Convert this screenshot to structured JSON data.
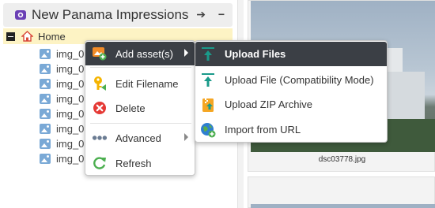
{
  "header": {
    "title": "New Panama Impressions",
    "arrow_glyph": "➔",
    "menu_glyph": "−"
  },
  "tree": {
    "home_label": "Home",
    "items": [
      "img_0",
      "img_0",
      "img_0",
      "img_0",
      "img_0",
      "img_0",
      "img_0",
      "img_0"
    ]
  },
  "context_menu": {
    "add_assets": "Add asset(s)",
    "edit_filename": "Edit Filename",
    "delete": "Delete",
    "advanced": "Advanced",
    "refresh": "Refresh"
  },
  "submenu": {
    "upload_files": "Upload Files",
    "upload_compat": "Upload File (Compatibility Mode)",
    "upload_zip": "Upload ZIP Archive",
    "import_url": "Import from URL"
  },
  "thumbnail": {
    "caption": "dsc03778.jpg"
  },
  "colors": {
    "menu_active_bg": "#3b3f45",
    "tree_selected_bg": "#fdf3c4",
    "upload_teal": "#1a9a8a",
    "delete_red": "#e53935",
    "refresh_green": "#4caf50",
    "zip_orange": "#f5a623"
  }
}
